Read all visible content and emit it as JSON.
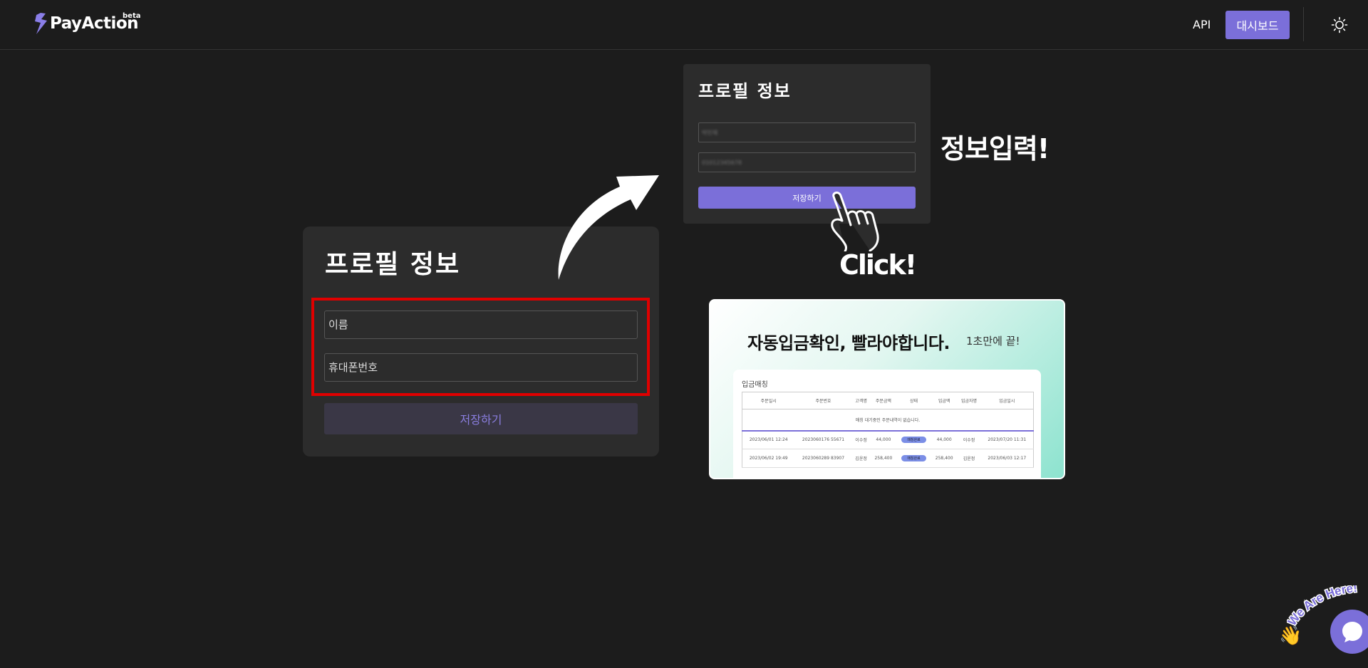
{
  "header": {
    "logo_text": "PayAction",
    "logo_badge": "beta",
    "api_label": "API",
    "dashboard_label": "대시보드",
    "accent": "#7b6fd9"
  },
  "profile_large": {
    "title": "프로필 정보",
    "name_placeholder": "이름",
    "phone_placeholder": "휴대폰번호",
    "save_label": "저장하기",
    "highlight_color": "#e00000"
  },
  "profile_small": {
    "title": "프로필 정보",
    "name_value": "박민재",
    "phone_value": "01012345678",
    "save_label": "저장하기"
  },
  "annotations": {
    "info_label": "정보입력!",
    "click_label": "Click!"
  },
  "promo": {
    "headline": "자동입금확인, 빨라야합니다.",
    "subline": "1초만에 끝!",
    "panel_title": "입금매칭",
    "columns": [
      "주문일시",
      "주문번호",
      "고객명",
      "주문금액",
      "상태",
      "입금액",
      "입금자명",
      "입금일시"
    ],
    "empty_message": "매칭 대기중인 주문내역이 없습니다.",
    "rows": [
      {
        "order_date": "2023/06/01 12:24",
        "order_no": "2023060176 55671",
        "customer": "이수정",
        "amount": "44,000",
        "status": "매칭완료",
        "deposit": "44,000",
        "depositor": "이수정",
        "deposit_date": "2023/07/20 11:31"
      },
      {
        "order_date": "2023/06/02 19:49",
        "order_no": "2023060289 83907",
        "customer": "김윤정",
        "amount": "258,400",
        "status": "매칭완료",
        "deposit": "258,400",
        "depositor": "김윤정",
        "deposit_date": "2023/06/03 12:17"
      }
    ]
  },
  "chat": {
    "badge_text": "We Are Here!"
  },
  "icons": [
    "lightning-bolt-icon",
    "sun-icon",
    "arrow-icon",
    "pointing-hand-icon",
    "waving-hand-icon",
    "chat-bubble-icon"
  ]
}
